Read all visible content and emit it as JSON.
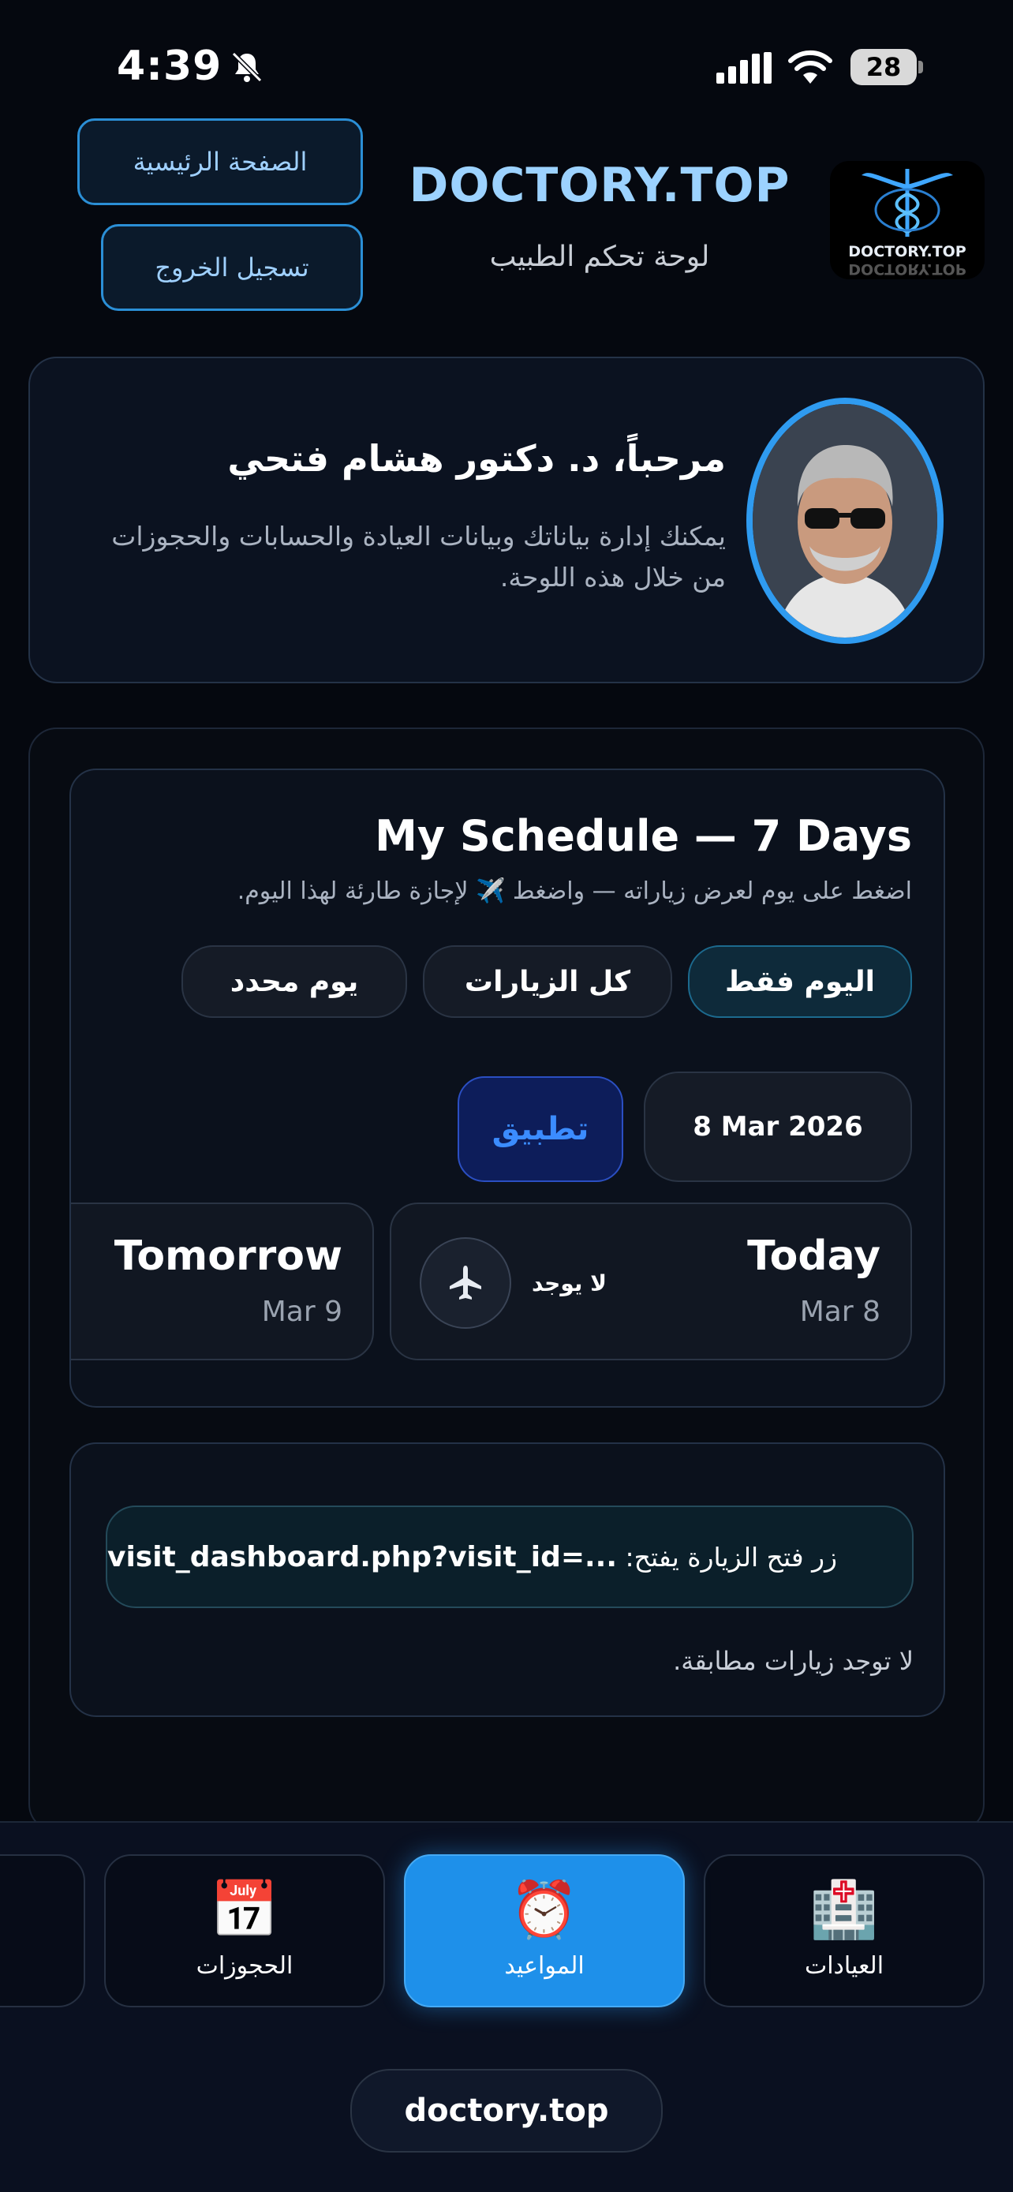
{
  "status_bar": {
    "time": "4:39",
    "battery": "28",
    "icons": [
      "bell-slash-icon",
      "signal-icon",
      "wifi-icon",
      "battery-icon"
    ]
  },
  "header": {
    "home_label": "الصفحة الرئيسية",
    "logout_label": "تسجيل الخروج",
    "brand_title": "DOCTORY.TOP",
    "brand_subtitle": "لوحة تحكم الطبيب",
    "logo_text": "DOCTORY.TOP"
  },
  "welcome": {
    "title": "مرحباً، د. دكتور هشام فتحي",
    "text": "يمكنك إدارة بياناتك وبيانات العيادة والحسابات والحجوزات من خلال هذه اللوحة."
  },
  "schedule": {
    "title": "My Schedule — 7 Days",
    "hint": "اضغط على يوم لعرض زياراته — واضغط ✈️ لإجازة طارئة لهذا اليوم.",
    "filters": {
      "today_only": "اليوم فقط",
      "all_visits": "كل الزيارات",
      "specific_day": "يوم محدد"
    },
    "date_value": "8 Mar 2026",
    "apply_label": "تطبيق",
    "days": [
      {
        "name": "Today",
        "date": "Mar 8",
        "status": "لا يوجد"
      },
      {
        "name": "Tomorrow",
        "date": "Mar 9"
      }
    ]
  },
  "visits": {
    "url_prefix": "زر فتح الزيارة يفتح:",
    "url_code": "visit_dashboard.php?visit_id=...",
    "empty_text": "لا توجد زيارات مطابقة."
  },
  "bottom_nav": {
    "tabs": [
      {
        "label": "العيادات",
        "icon": "🏥"
      },
      {
        "label": "المواعيد",
        "icon": "⏰"
      },
      {
        "label": "الحجوزات",
        "icon": "📅"
      }
    ],
    "active_tab": "المواعيد",
    "url": "doctory.top"
  },
  "colors": {
    "accent": "#1e90ea",
    "brand": "#9cd2ff",
    "background": "#05080f"
  }
}
